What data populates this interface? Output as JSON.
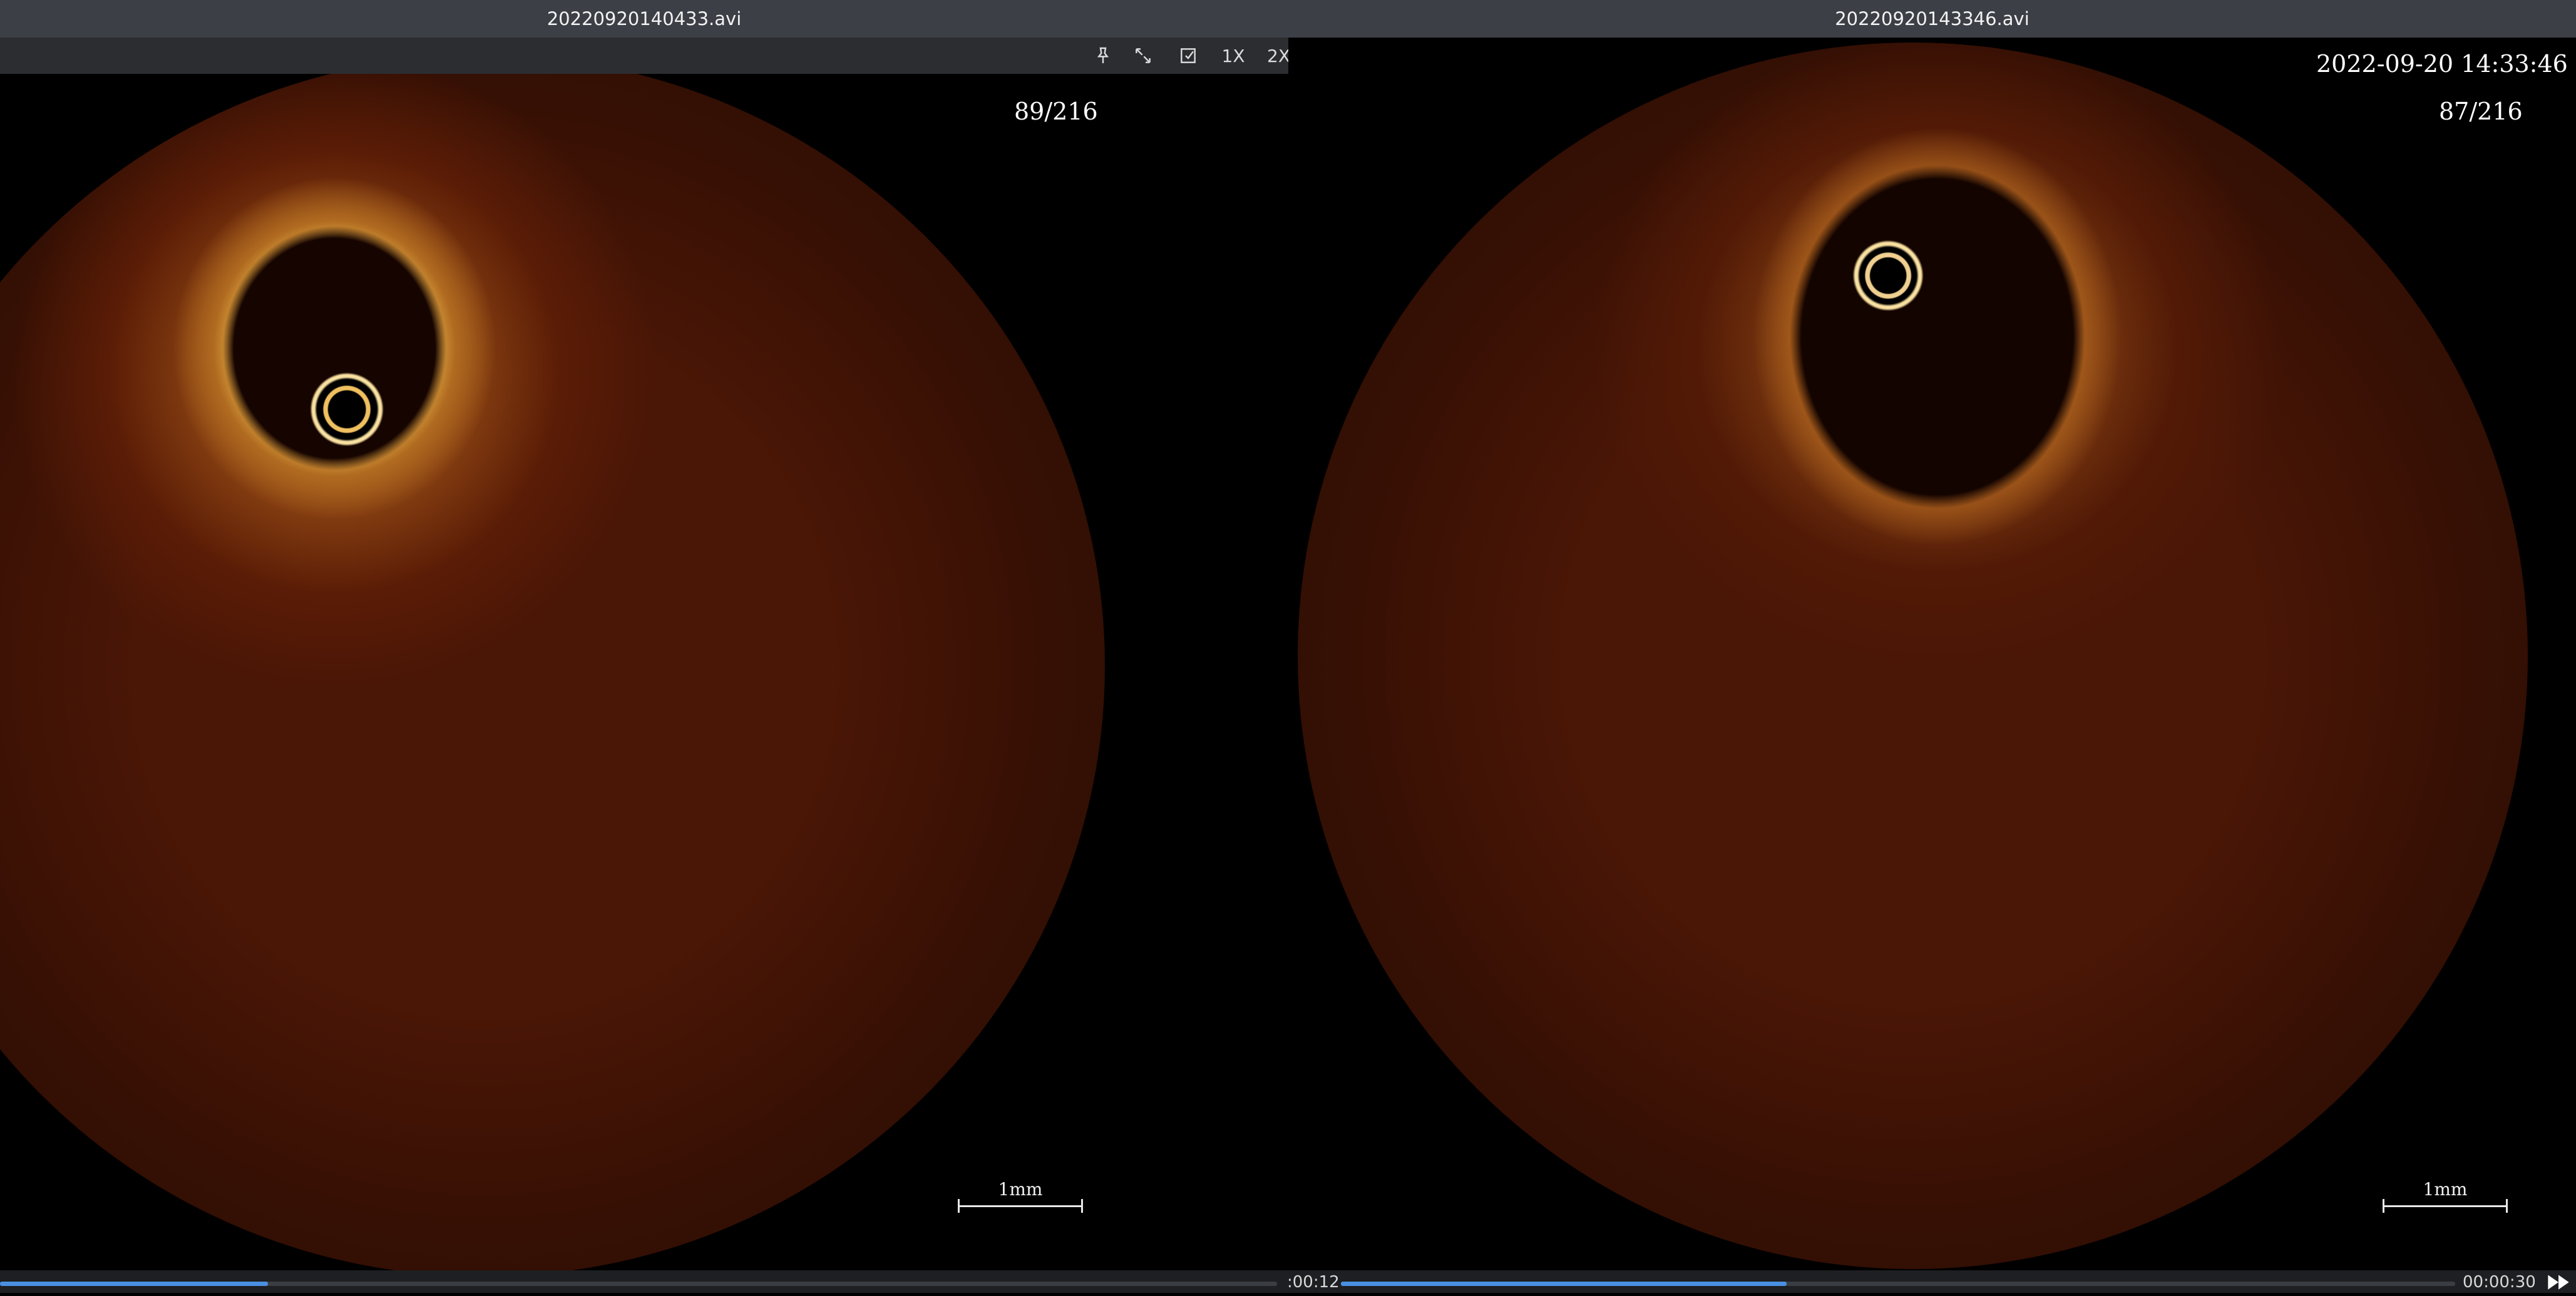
{
  "left": {
    "title": "20220920140433.avi",
    "toolbar": {
      "pin_icon": "pin-icon",
      "expand_icon": "expand-icon",
      "export_icon": "export-icon",
      "zoom1": "1X",
      "zoom2": "2X"
    },
    "frame_counter": "89/216",
    "scale_label": "1mm",
    "time": ":00:12",
    "progress": 0.21
  },
  "right": {
    "title": "20220920143346.avi",
    "timestamp": "2022-09-20 14:33:46",
    "frame_counter": "87/216",
    "scale_label": "1mm",
    "time": "00:00:30",
    "progress": 0.4
  },
  "colors": {
    "scan_dark": "#3a1004",
    "scan_bright": "#f3c452",
    "progress_fill": "#4a90e2"
  },
  "play_icon": "play-next-icon"
}
